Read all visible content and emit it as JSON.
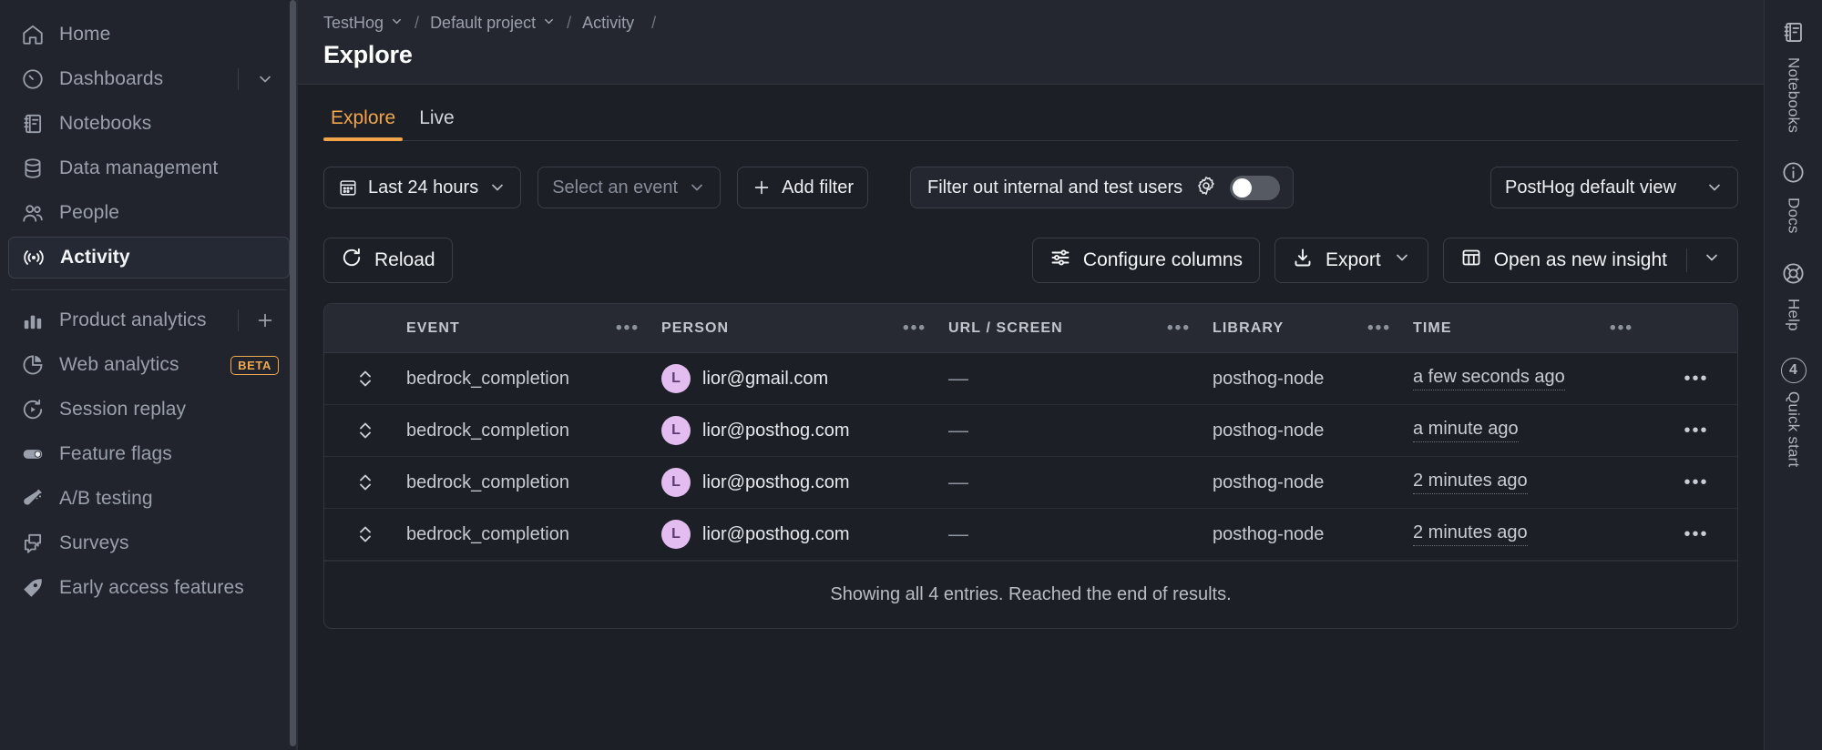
{
  "sidebar": {
    "primary_items": [
      {
        "label": "Home",
        "icon": "home-icon"
      },
      {
        "label": "Dashboards",
        "icon": "dashboard-gauge-icon",
        "trailing": "chevron-down-icon"
      },
      {
        "label": "Notebooks",
        "icon": "notebook-icon"
      },
      {
        "label": "Data management",
        "icon": "database-icon"
      },
      {
        "label": "People",
        "icon": "people-icon"
      },
      {
        "label": "Activity",
        "icon": "broadcast-icon",
        "active": true
      }
    ],
    "product_items": [
      {
        "label": "Product analytics",
        "icon": "bar-chart-icon",
        "trailing": "plus-icon"
      },
      {
        "label": "Web analytics",
        "icon": "pie-chart-icon",
        "badge": "BETA"
      },
      {
        "label": "Session replay",
        "icon": "replay-icon"
      },
      {
        "label": "Feature flags",
        "icon": "toggle-icon"
      },
      {
        "label": "A/B testing",
        "icon": "flask-icon"
      },
      {
        "label": "Surveys",
        "icon": "survey-icon"
      },
      {
        "label": "Early access features",
        "icon": "rocket-icon"
      }
    ]
  },
  "breadcrumb": {
    "org": "TestHog",
    "project": "Default project",
    "section": "Activity",
    "separator": "/"
  },
  "page": {
    "title": "Explore"
  },
  "tabs": [
    {
      "label": "Explore",
      "active": true
    },
    {
      "label": "Live",
      "active": false
    }
  ],
  "filters": {
    "date_range": "Last 24 hours",
    "event_placeholder": "Select an event",
    "add_filter": "Add filter",
    "internal_users_label": "Filter out internal and test users",
    "internal_users_toggle": "off",
    "view_select": "PostHog default view"
  },
  "actions": {
    "reload": "Reload",
    "configure_columns": "Configure columns",
    "export": "Export",
    "open_as_new_insight": "Open as new insight"
  },
  "table": {
    "columns": [
      "EVENT",
      "PERSON",
      "URL / SCREEN",
      "LIBRARY",
      "TIME"
    ],
    "column_menu_glyph": "•••",
    "rows": [
      {
        "event": "bedrock_completion",
        "person_initial": "L",
        "person": "lior@gmail.com",
        "url": "—",
        "library": "posthog-node",
        "time": "a few seconds ago"
      },
      {
        "event": "bedrock_completion",
        "person_initial": "L",
        "person": "lior@posthog.com",
        "url": "—",
        "library": "posthog-node",
        "time": "a minute ago"
      },
      {
        "event": "bedrock_completion",
        "person_initial": "L",
        "person": "lior@posthog.com",
        "url": "—",
        "library": "posthog-node",
        "time": "2 minutes ago"
      },
      {
        "event": "bedrock_completion",
        "person_initial": "L",
        "person": "lior@posthog.com",
        "url": "—",
        "library": "posthog-node",
        "time": "2 minutes ago"
      }
    ],
    "footer": "Showing all 4 entries. Reached the end of results."
  },
  "rail": [
    {
      "label": "Notebooks",
      "icon": "notebook-icon"
    },
    {
      "label": "Docs",
      "icon": "info-circle-icon"
    },
    {
      "label": "Help",
      "icon": "lifebuoy-icon"
    },
    {
      "label": "Quick start",
      "icon": "count-badge",
      "count": "4"
    }
  ],
  "colors": {
    "accent": "#f1a44a",
    "beta": "#f0a94e",
    "avatar_bg": "#e3bdf0",
    "panel": "#21242c",
    "canvas": "#1d1f27"
  }
}
